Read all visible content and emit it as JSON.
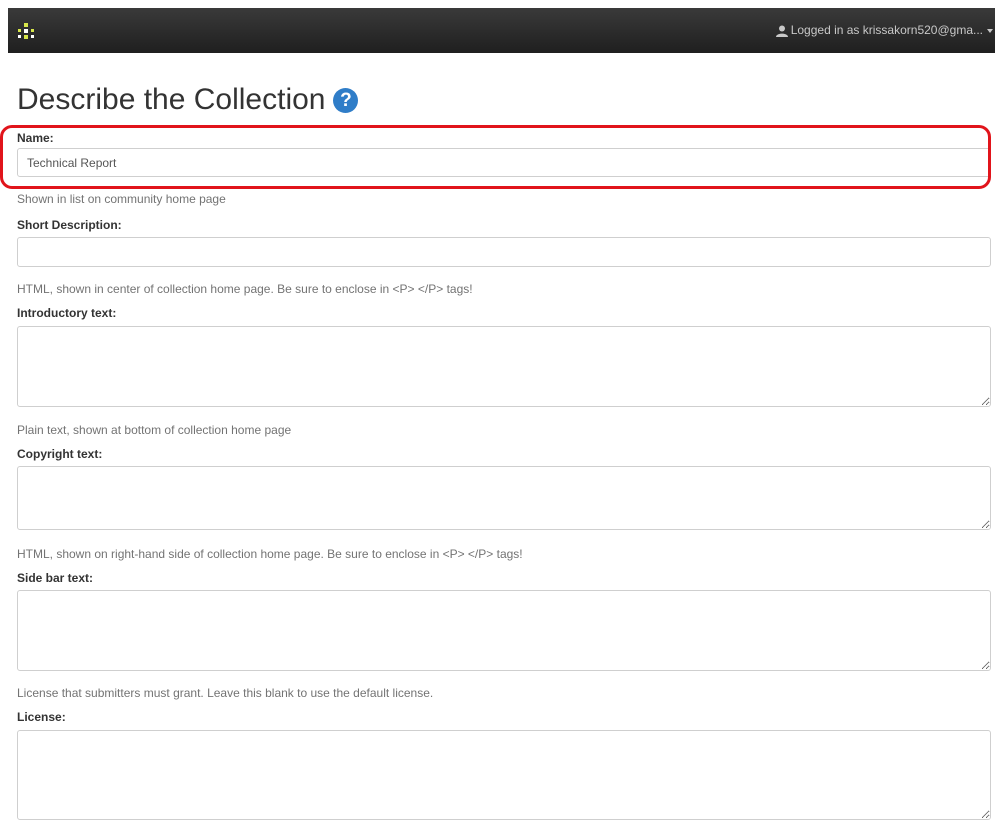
{
  "navbar": {
    "logo_icon": "dspace-logo-icon",
    "user_icon": "person-icon",
    "user_text": "Logged in as krissakorn520@gma..."
  },
  "page": {
    "title": "Describe the Collection",
    "help_icon": "question-circle-icon",
    "help_glyph": "?"
  },
  "form": {
    "name_label": "Name:",
    "name_value": "Technical Report",
    "name_hint": "Shown in list on community home page",
    "short_desc_label": "Short Description:",
    "short_desc_value": "",
    "intro_hint": "HTML, shown in center of collection home page. Be sure to enclose in <P> </P> tags!",
    "intro_label": "Introductory text:",
    "copyright_hint": "Plain text, shown at bottom of collection home page",
    "copyright_label": "Copyright text:",
    "sidebar_hint": "HTML, shown on right-hand side of collection home page. Be sure to enclose in <P> </P> tags!",
    "sidebar_label": "Side bar text:",
    "license_hint": "License that submitters must grant. Leave this blank to use the default license.",
    "license_label": "License:"
  },
  "colors": {
    "highlight": "#e1141b",
    "help_icon": "#2f7dc8",
    "navbar": "#2a2a2a"
  }
}
